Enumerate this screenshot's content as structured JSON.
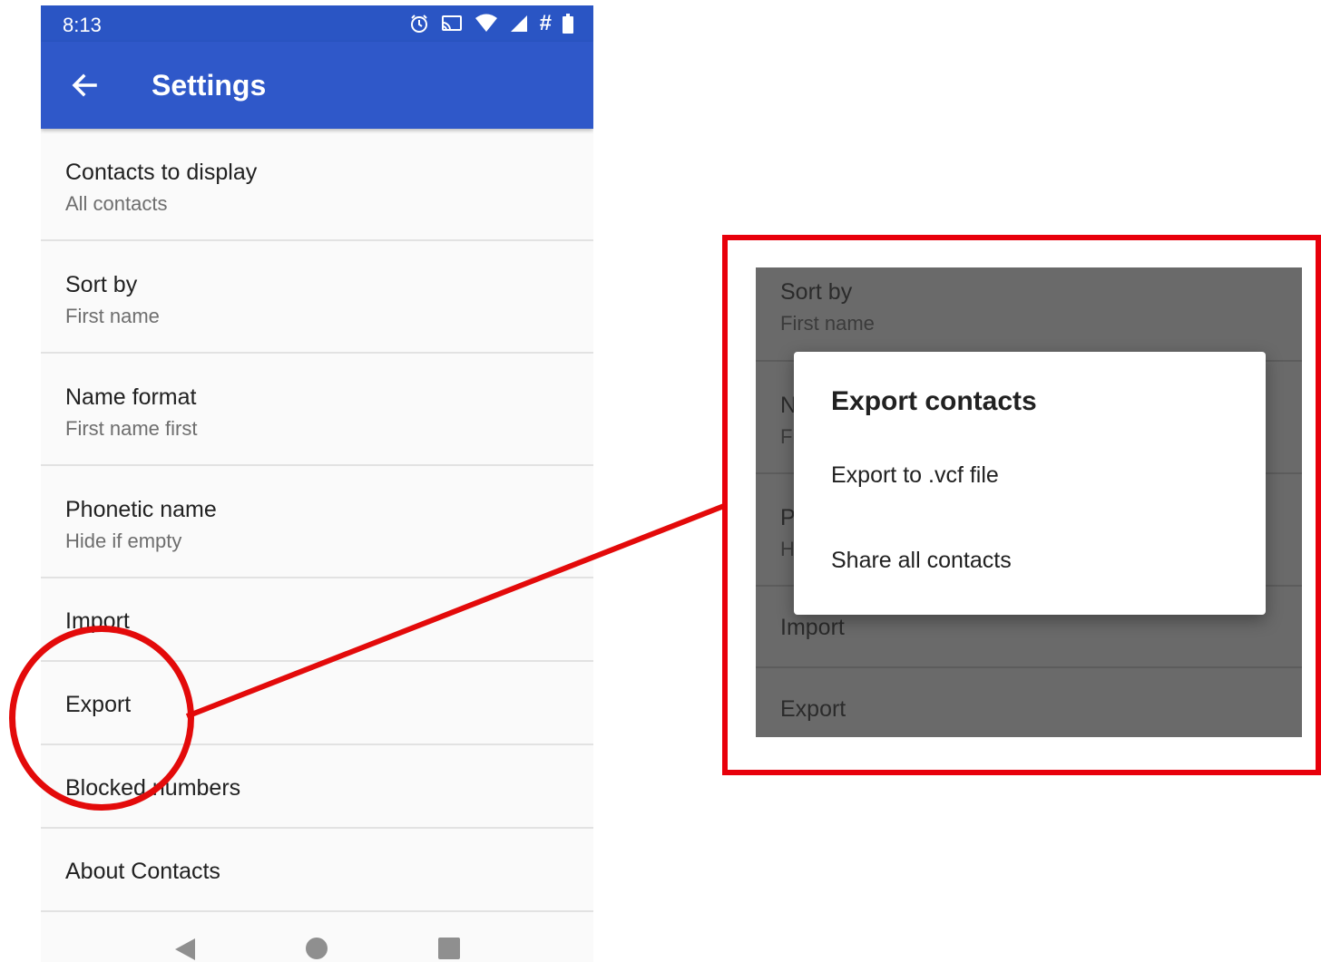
{
  "status_bar": {
    "time": "8:13",
    "icons": [
      "alarm-icon",
      "cast-icon",
      "wifi-icon",
      "signal-icon",
      "hash-icon",
      "battery-icon"
    ],
    "hash_symbol": "#"
  },
  "app_bar": {
    "title": "Settings",
    "back_icon": "arrow-left-icon"
  },
  "settings": {
    "items": [
      {
        "primary": "Contacts to display",
        "secondary": "All contacts"
      },
      {
        "primary": "Sort by",
        "secondary": "First name"
      },
      {
        "primary": "Name format",
        "secondary": "First name first"
      },
      {
        "primary": "Phonetic name",
        "secondary": "Hide if empty"
      },
      {
        "primary": "Import"
      },
      {
        "primary": "Export"
      },
      {
        "primary": "Blocked numbers"
      },
      {
        "primary": "About Contacts"
      }
    ]
  },
  "zoom_panel": {
    "rows": [
      {
        "primary": "Sort by",
        "secondary": "First name"
      },
      {
        "primary": "N",
        "secondary": "Fi"
      },
      {
        "primary": "P",
        "secondary": "H"
      },
      {
        "primary": "Import"
      },
      {
        "primary": "Export"
      }
    ],
    "dialog": {
      "title": "Export contacts",
      "options": [
        "Export to .vcf file",
        "Share all contacts"
      ]
    }
  },
  "colors": {
    "app_bar": "#2f58c9",
    "status_bar": "#2a55c4",
    "annotation_red": "#e30a0a",
    "scrim": "#6a6a6a"
  }
}
